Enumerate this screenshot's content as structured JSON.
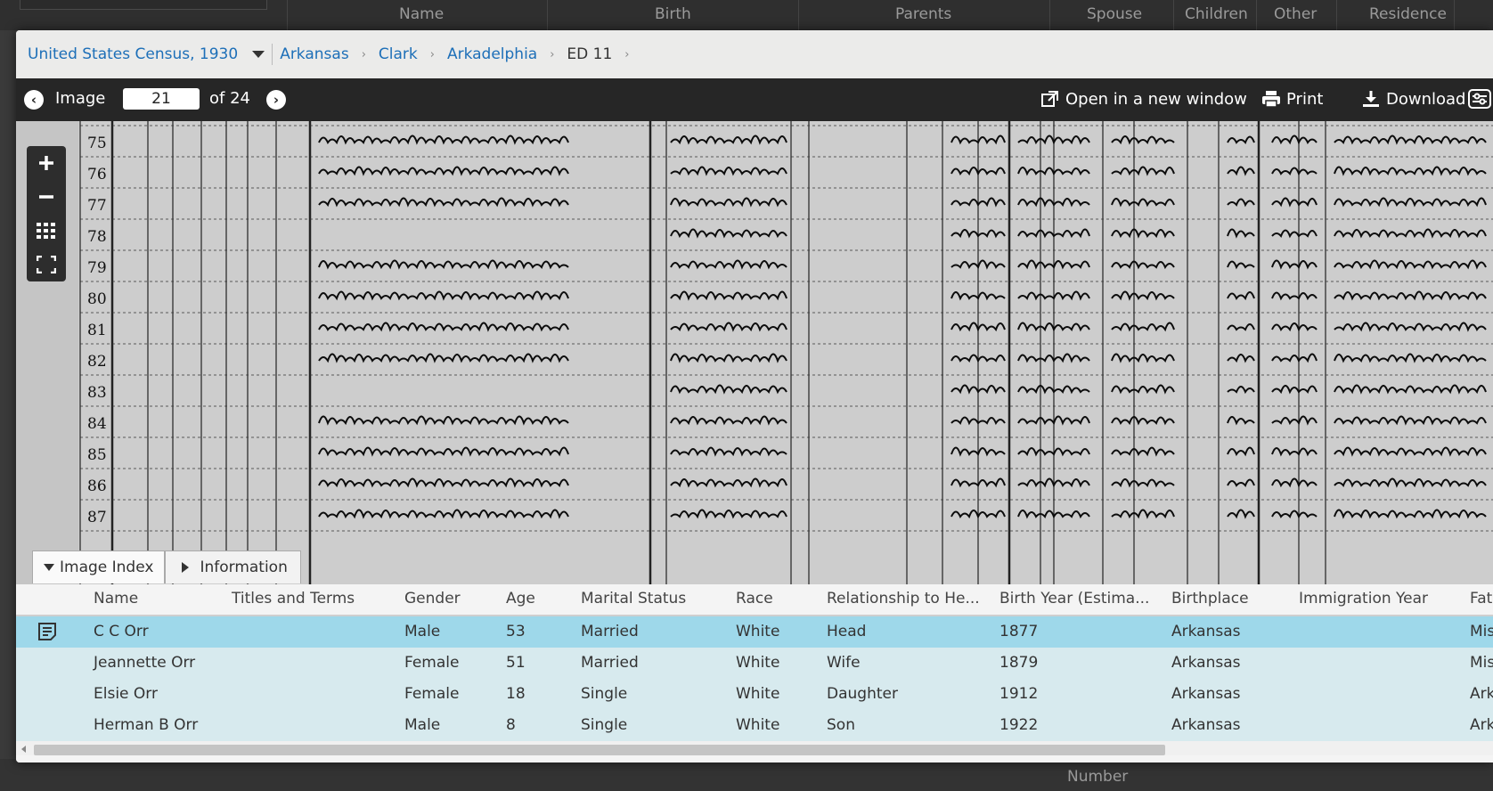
{
  "background": {
    "columns": [
      "Name",
      "Birth",
      "Parents",
      "Spouse",
      "Children",
      "Other",
      "Residence"
    ],
    "footer_text": "Number"
  },
  "breadcrumbs": {
    "collection": "United States Census, 1930",
    "items": [
      "Arkansas",
      "Clark",
      "Arkadelphia"
    ],
    "current": "ED 11"
  },
  "toolbar": {
    "image_label": "Image",
    "page_value": "21",
    "of_label": "of 24",
    "open_new_window": "Open in a new window",
    "print": "Print",
    "download": "Download"
  },
  "census_image": {
    "line_numbers": [
      "75",
      "76",
      "77",
      "78",
      "79",
      "80",
      "81",
      "82",
      "83",
      "84",
      "85",
      "86",
      "87"
    ]
  },
  "tabs": {
    "image_index": "Image Index",
    "information": "Information"
  },
  "index_table": {
    "columns": [
      "Name",
      "Titles and Terms",
      "Gender",
      "Age",
      "Marital Status",
      "Race",
      "Relationship to He...",
      "Birth Year (Estima...",
      "Birthplace",
      "Immigration Year",
      "Fat"
    ],
    "rows": [
      {
        "name": "C C Orr",
        "titles": "",
        "gender": "Male",
        "age": "53",
        "marital": "Married",
        "race": "White",
        "relationship": "Head",
        "birth_year": "1877",
        "birthplace": "Arkansas",
        "immigration": "",
        "father": "Mis"
      },
      {
        "name": "Jeannette Orr",
        "titles": "",
        "gender": "Female",
        "age": "51",
        "marital": "Married",
        "race": "White",
        "relationship": "Wife",
        "birth_year": "1879",
        "birthplace": "Arkansas",
        "immigration": "",
        "father": "Mis"
      },
      {
        "name": "Elsie Orr",
        "titles": "",
        "gender": "Female",
        "age": "18",
        "marital": "Single",
        "race": "White",
        "relationship": "Daughter",
        "birth_year": "1912",
        "birthplace": "Arkansas",
        "immigration": "",
        "father": "Ark"
      },
      {
        "name": "Herman B Orr",
        "titles": "",
        "gender": "Male",
        "age": "8",
        "marital": "Single",
        "race": "White",
        "relationship": "Son",
        "birth_year": "1922",
        "birthplace": "Arkansas",
        "immigration": "",
        "father": "Ark"
      }
    ]
  },
  "colors": {
    "link": "#1d6fb8",
    "toolbar_bg": "#262626",
    "selected_row": "#9ed8ea",
    "row_bg": "#d7eaee"
  }
}
